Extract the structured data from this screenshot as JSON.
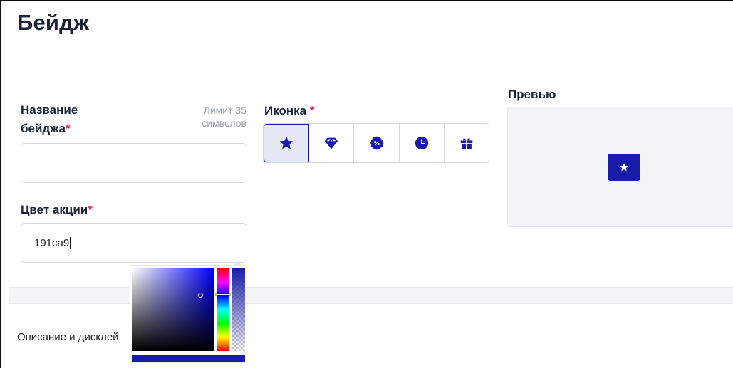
{
  "page": {
    "title": "Бейдж"
  },
  "form": {
    "badge_name": {
      "label_line1": "Название",
      "label_line2": "бейджа",
      "required_mark": "*",
      "limit_line1": "Лимит 35",
      "limit_line2": "символов",
      "value": ""
    },
    "icon": {
      "label": "Иконка",
      "required_mark": "*",
      "options": [
        "star-icon",
        "diamond-icon",
        "percent-badge-icon",
        "clock-icon",
        "gift-icon"
      ],
      "selected": "star-icon"
    },
    "promo_color": {
      "label": "Цвет акции",
      "required_mark": "*",
      "value": "191ca9"
    },
    "preview": {
      "label": "Превью",
      "badge_icon": "star-icon"
    }
  },
  "color_picker": {
    "current_color": "#191ca9"
  },
  "section": {
    "description_label": "Описание и дисклей"
  },
  "colors": {
    "accent": "#1a1ca9",
    "required": "#e0245e"
  }
}
